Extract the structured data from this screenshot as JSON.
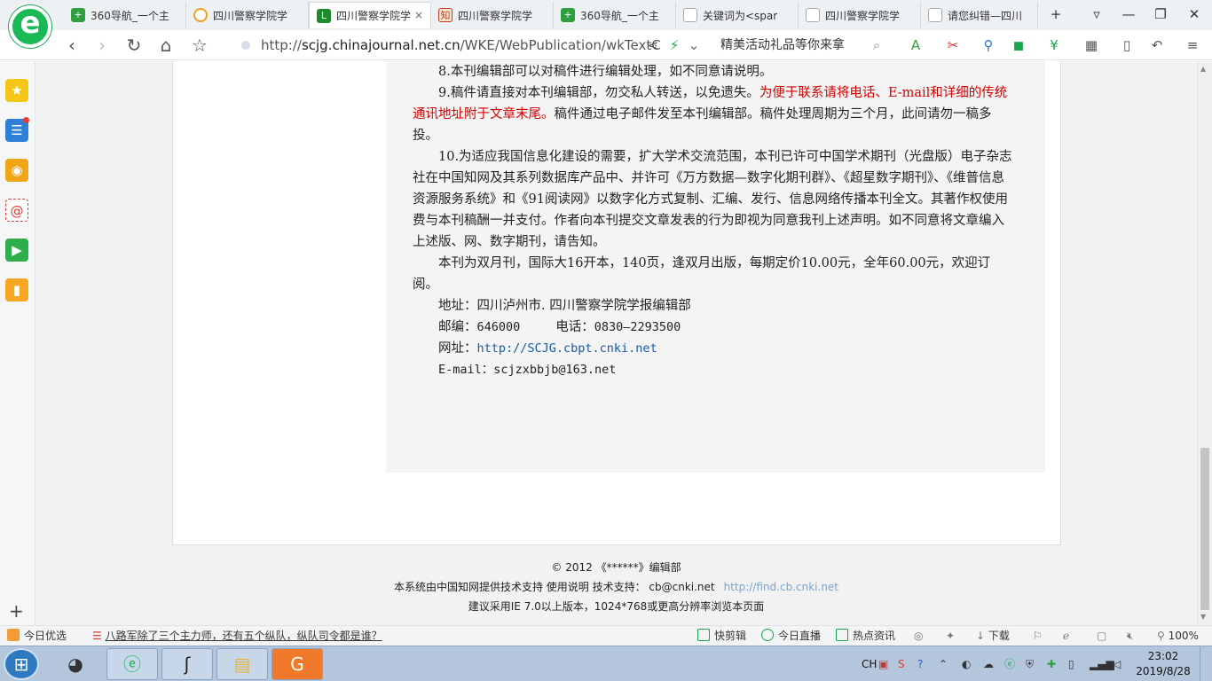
{
  "tabs": [
    {
      "label": "360导航_一个主",
      "icon": "navigation-360-icon",
      "color": "#2e9e3e"
    },
    {
      "label": "四川警察学院学",
      "icon": "loading-icon",
      "color": "#f0a020"
    },
    {
      "label": "四川警察学院学",
      "icon": "journal-icon",
      "color": "#1d8a2b"
    },
    {
      "label": "四川警察学院学",
      "icon": "cnki-icon",
      "color": "#c0392b"
    },
    {
      "label": "360导航_一个主",
      "icon": "navigation-360-icon",
      "color": "#2e9e3e"
    },
    {
      "label": "关键词为<spar",
      "icon": "page-icon",
      "color": "#bbbbbb"
    },
    {
      "label": "四川警察学院学",
      "icon": "page-icon",
      "color": "#bbbbbb"
    },
    {
      "label": "请您纠错—四川",
      "icon": "page-icon",
      "color": "#bbbbbb"
    }
  ],
  "tab_close": "×",
  "new_tab": "+",
  "address": {
    "prefix": "http://",
    "host": "scjg.chinajournal.net.cn",
    "path": "/WKE/WebPublication/wkTextC"
  },
  "search": {
    "text": "精美活动礼品等你来拿"
  },
  "nav": {
    "back": "‹",
    "forward": "›",
    "refresh": "↻",
    "home": "⌂",
    "star": "☆"
  },
  "article": {
    "p8": "8.本刊编辑部可以对稿件进行编辑处理，如不同意请说明。",
    "p9_a": "9.稿件请直接对本刊编辑部，勿交私人转送，以免遗失。",
    "p9_red": "为便于联系请将电话、E-mail和详细的传统通讯地址附于文章末尾。",
    "p9_b": "稿件通过电子邮件发至本刊编辑部。稿件处理周期为三个月，此间请勿一稿多投。",
    "p10": "10.为适应我国信息化建设的需要，扩大学术交流范围，本刊已许可中国学术期刊（光盘版）电子杂志社在中国知网及其系列数据库产品中、并许可《万方数据—数字化期刊群》、《超星数字期刊》、《维普信息资源服务系统》和《91阅读网》以数字化方式复制、汇编、发行、信息网络传播本刊全文。其著作权使用费与本刊稿酬一并支付。作者向本刊提交文章发表的行为即视为同意我刊上述声明。如不同意将文章编入上述版、网、数字期刊，请告知。",
    "pub": "本刊为双月刊，国际大16开本，140页，逢双月出版，每期定价10.00元，全年60.00元，欢迎订阅。",
    "address": "地址：四川泸州市. 四川警察学院学报编辑部",
    "postcode_label": "邮编：",
    "postcode": "646000",
    "phone_label": "电话：",
    "phone": "0830—2293500",
    "website_label": "网址：",
    "website": "http://SCJG.cbpt.cnki.net",
    "email": "E-mail：scjzxbbjb@163.net"
  },
  "footer": {
    "copyright": "© 2012 《******》编辑部",
    "support": "本系统由中国知网提供技术支持 使用说明 技术支持：  cb@cnki.net",
    "support_link": "http://find.cb.cnki.net",
    "browser_note": "建议采用IE 7.0以上版本，1024*768或更高分辨率浏览本页面"
  },
  "statusbar": {
    "today_pick": "今日优选",
    "headline": "八路军除了三个主力师，还有五个纵队，纵队司令都是谁？",
    "kuaijianji": "快剪辑",
    "live": "今日直播",
    "hot": "热点资讯",
    "download": "下载",
    "zoom": "100%"
  },
  "taskbar": {
    "lang": "CH",
    "time": "23:02",
    "date": "2019/8/28"
  }
}
